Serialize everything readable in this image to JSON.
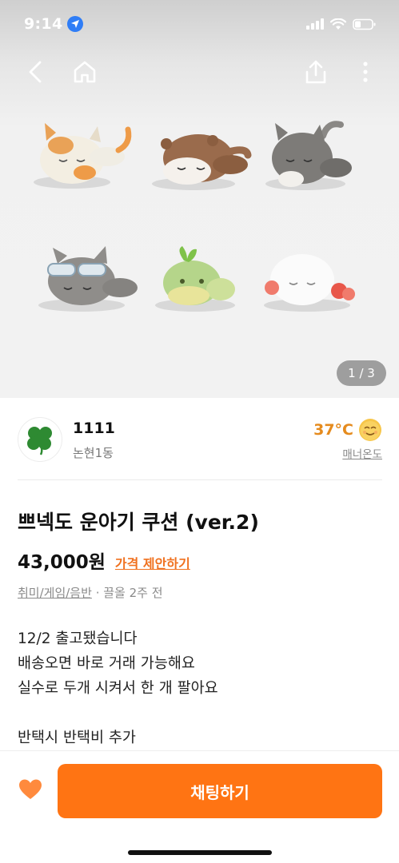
{
  "status_bar": {
    "time": "9:14",
    "location_icon": "location-arrow-icon",
    "signal_icon": "cellular-signal-icon",
    "wifi_icon": "wifi-icon",
    "battery_icon": "battery-icon"
  },
  "nav": {
    "back_icon": "chevron-left-icon",
    "home_icon": "home-icon",
    "share_icon": "share-icon",
    "more_icon": "more-vertical-icon"
  },
  "gallery": {
    "page_indicator": "1 / 3",
    "items": [
      {
        "icon": "calico-cat-plush"
      },
      {
        "icon": "otter-plush"
      },
      {
        "icon": "gray-cat-plush"
      },
      {
        "icon": "goggles-cat-plush"
      },
      {
        "icon": "green-sprout-plush"
      },
      {
        "icon": "white-ghost-plush"
      }
    ]
  },
  "seller": {
    "avatar_icon": "four-leaf-clover-icon",
    "name": "1111",
    "region": "논현1동",
    "temperature": "37°C",
    "temperature_icon": "smiling-face-icon",
    "manner_label": "매너온도"
  },
  "product": {
    "title": "쁘넥도 운아기 쿠션 (ver.2)",
    "price": "43,000원",
    "offer_label": "가격 제안하기",
    "category": "취미/게임/음반",
    "meta_suffix": "· 끌올 2주 전",
    "description": [
      "12/2 출고됐습니다",
      "배송오면 바로 거래 가능해요",
      "실수로 두개 시켜서 한 개 팔아요",
      "",
      "반택시 반택비 추가"
    ]
  },
  "bottom": {
    "like_icon": "heart-icon",
    "chat_label": "채팅하기"
  },
  "colors": {
    "accent": "#ff7413",
    "temperature": "#e58b1e",
    "heart": "#ff8a3d",
    "offer_link": "#f0711f"
  }
}
